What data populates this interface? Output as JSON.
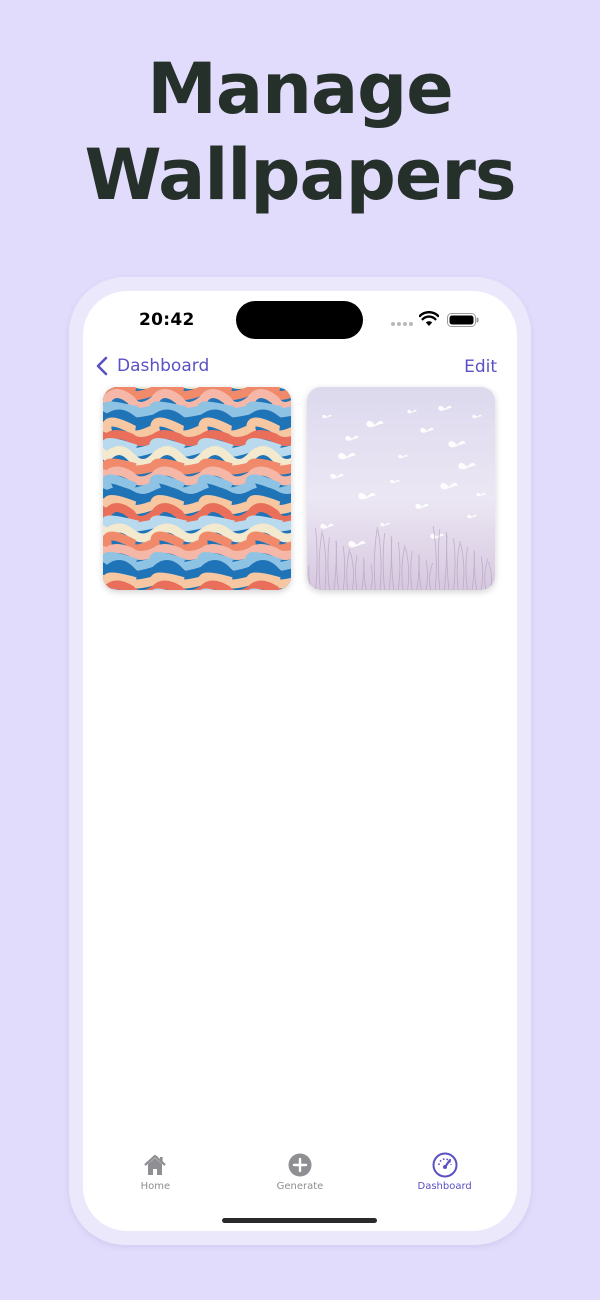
{
  "headline": {
    "line1": "Manage",
    "line2": "Wallpapers"
  },
  "status_bar": {
    "time": "20:42"
  },
  "nav": {
    "back_label": "Dashboard",
    "edit_label": "Edit"
  },
  "wallpapers": [
    {
      "name": "waves"
    },
    {
      "name": "butterflies"
    }
  ],
  "tabs": [
    {
      "label": "Home",
      "icon": "house-icon",
      "active": false
    },
    {
      "label": "Generate",
      "icon": "plus-circle-icon",
      "active": false
    },
    {
      "label": "Dashboard",
      "icon": "gauge-icon",
      "active": true
    }
  ],
  "colors": {
    "accent": "#5a51c4",
    "background": "#e1dcfb",
    "headline": "#26302a",
    "inactive": "#8e8e93"
  }
}
